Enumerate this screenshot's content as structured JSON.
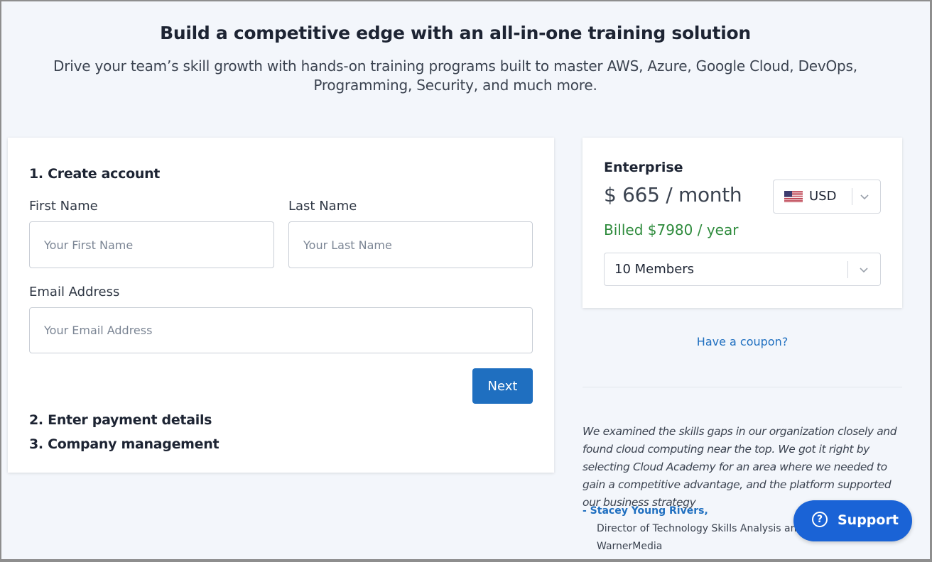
{
  "hero": {
    "title": "Build a competitive edge with an all-in-one training solution",
    "subtitle": "Drive your team’s skill growth with hands-on training programs built to master AWS, Azure, Google Cloud, DevOps, Programming, Security, and much more."
  },
  "form": {
    "step1": "1. Create account",
    "first_name_label": "First Name",
    "first_name_placeholder": "Your First Name",
    "first_name_value": "",
    "last_name_label": "Last Name",
    "last_name_placeholder": "Your Last Name",
    "last_name_value": "",
    "email_label": "Email Address",
    "email_placeholder": "Your Email Address",
    "email_value": "",
    "next_label": "Next",
    "step2": "2. Enter payment details",
    "step3": "3. Company management"
  },
  "plan": {
    "name": "Enterprise",
    "price": "$ 665 / month",
    "billed": "Billed $7980 / year",
    "currency": "USD",
    "currency_icon": "us-flag-icon",
    "members": "10 Members"
  },
  "coupon_link": "Have a coupon?",
  "testimonial": {
    "quote": "We examined the skills gaps in our organization closely and found cloud computing near the top. We got it right by selecting Cloud Academy for an area where we needed to gain a competitive advantage, and the platform supported our business strategy",
    "author": "- Stacey Young Rivers,",
    "author_title": "Director of Technology Skills Analysis and Development,",
    "company": "WarnerMedia"
  },
  "support": {
    "label": "Support",
    "icon": "question-circle-icon"
  },
  "colors": {
    "accent": "#1f6fc0",
    "billed_green": "#2e8b3c",
    "support_blue": "#1a63d6",
    "page_bg": "#f3f6fb"
  }
}
